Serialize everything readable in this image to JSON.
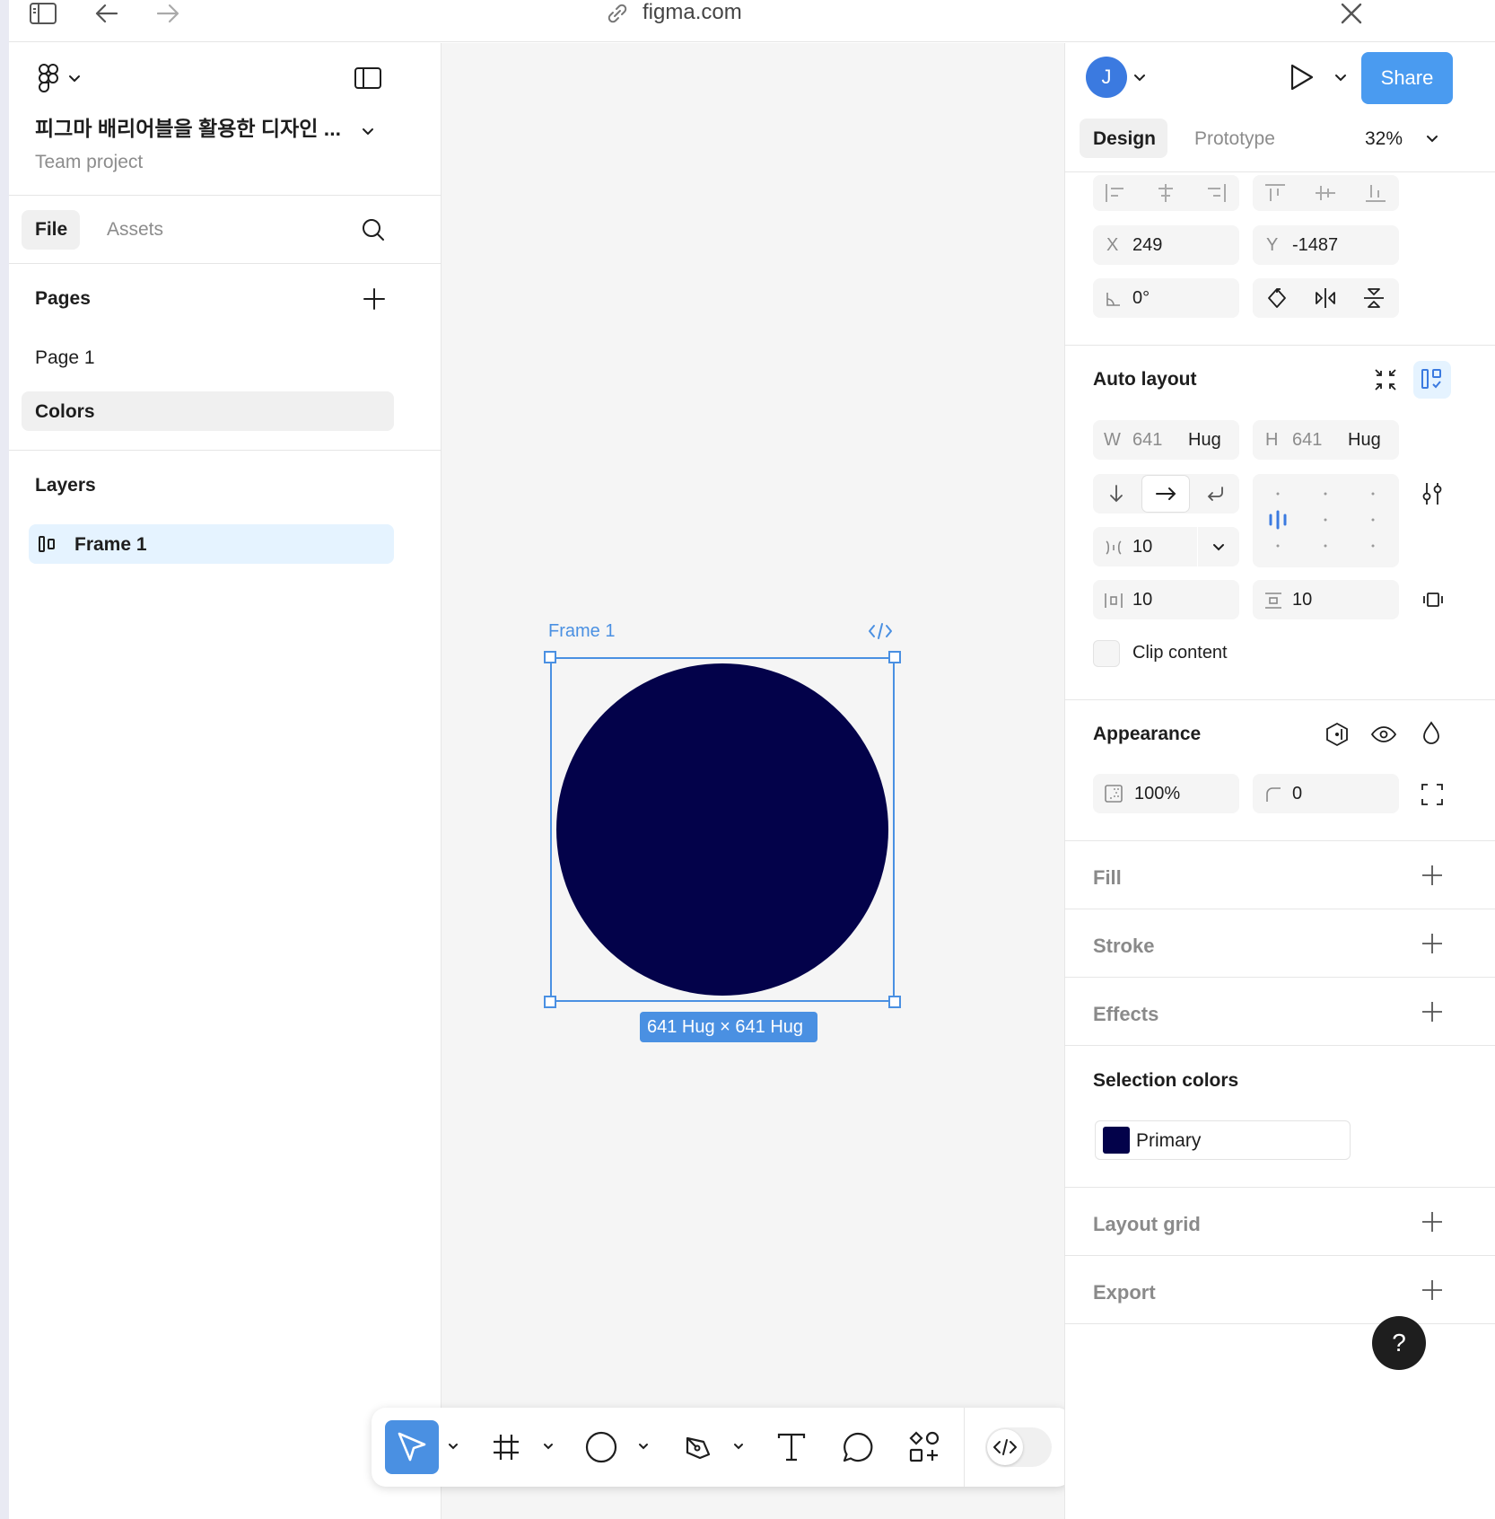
{
  "topbar": {
    "url": "figma.com"
  },
  "file": {
    "title": "피그마 배리어블을 활용한 디자인 ...",
    "subtitle": "Team project"
  },
  "left_tabs": {
    "file": "File",
    "assets": "Assets"
  },
  "pages": {
    "heading": "Pages",
    "items": [
      "Page 1",
      "Colors"
    ],
    "selected": "Colors"
  },
  "layers": {
    "heading": "Layers",
    "items": [
      "Frame 1"
    ]
  },
  "canvas": {
    "frame_label": "Frame 1",
    "size_badge": "641 Hug × 641 Hug",
    "circle_color": "#03024a",
    "selection_color": "#4a90e2"
  },
  "right": {
    "avatar": "J",
    "share": "Share",
    "tabs": {
      "design": "Design",
      "prototype": "Prototype"
    },
    "zoom": "32%",
    "position": {
      "x_label": "X",
      "x": "249",
      "y_label": "Y",
      "y": "-1487",
      "rotation": "0°"
    },
    "auto_layout": {
      "heading": "Auto layout",
      "w_label": "W",
      "w": "641",
      "w_mode": "Hug",
      "h_label": "H",
      "h": "641",
      "h_mode": "Hug",
      "gap": "10",
      "padding_h": "10",
      "padding_v": "10",
      "clip": "Clip content"
    },
    "appearance": {
      "heading": "Appearance",
      "opacity": "100%",
      "radius": "0"
    },
    "fill": "Fill",
    "stroke": "Stroke",
    "effects": "Effects",
    "selection_colors": {
      "heading": "Selection colors",
      "items": [
        {
          "name": "Primary",
          "color": "#03024a"
        }
      ]
    },
    "layout_grid": "Layout grid",
    "export": "Export",
    "help": "?"
  },
  "accent": "#4a90e2"
}
